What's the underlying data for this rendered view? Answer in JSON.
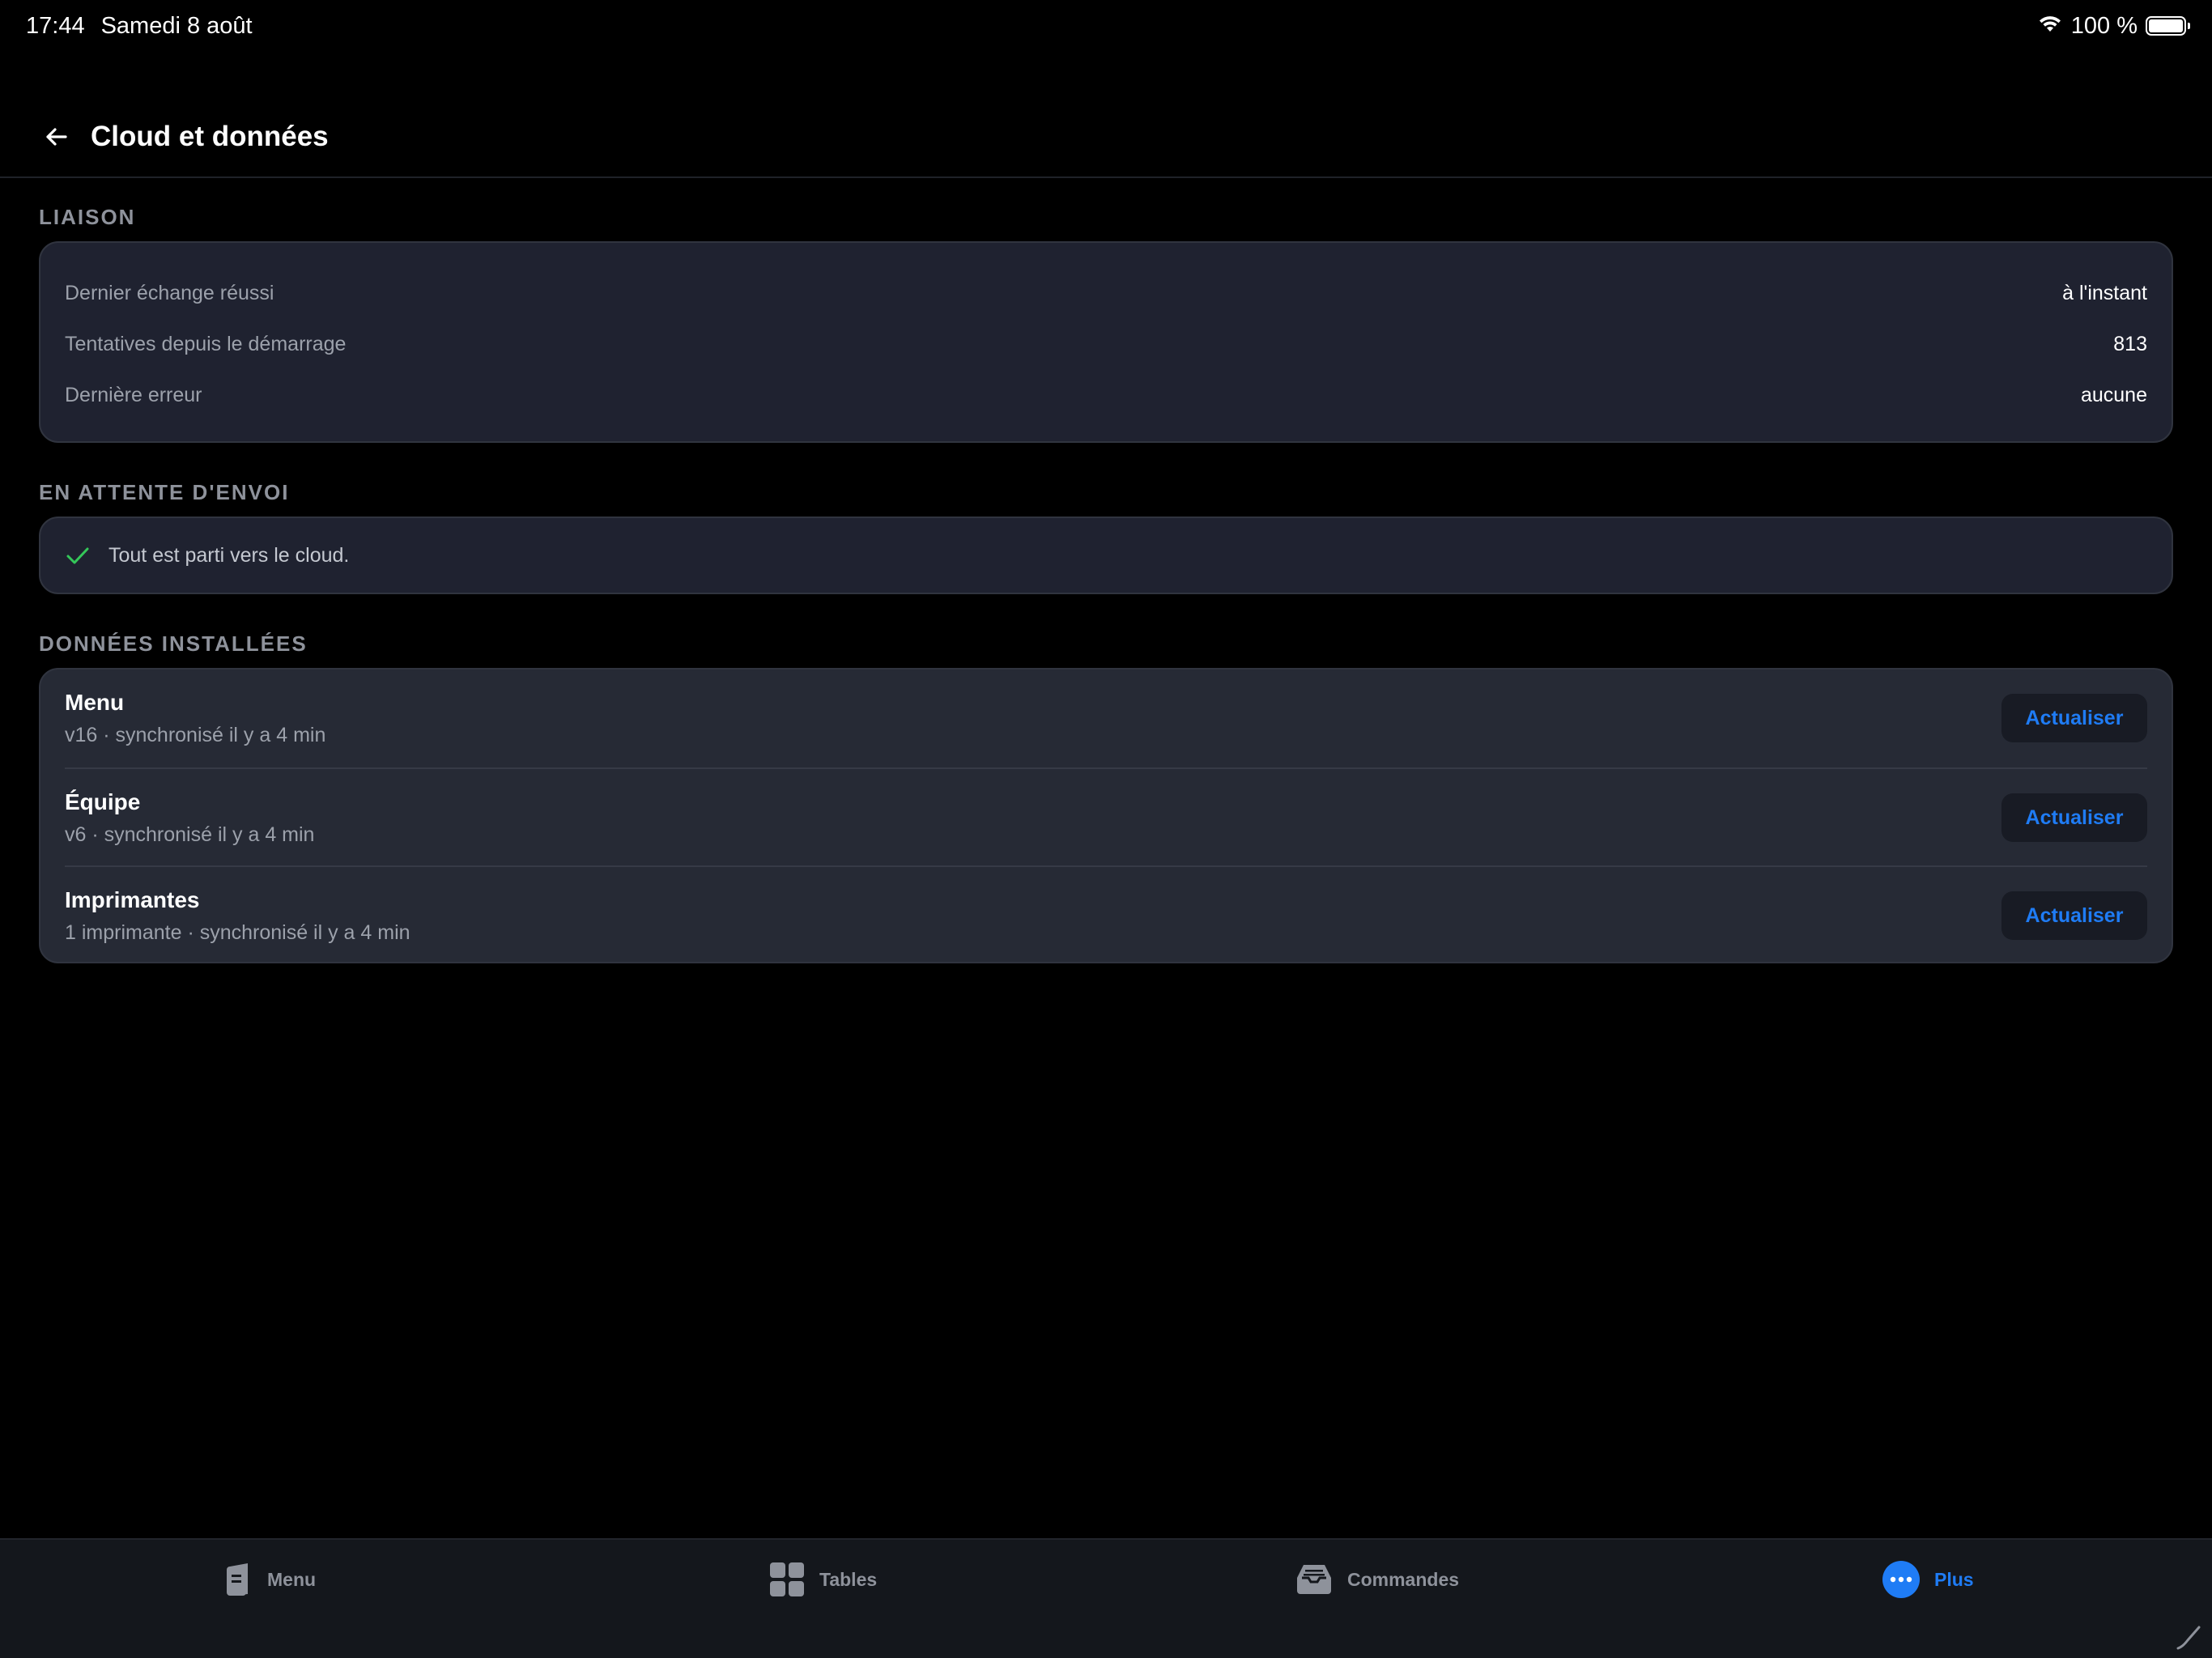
{
  "status_bar": {
    "time": "17:44",
    "date": "Samedi 8 août",
    "battery": "100 %"
  },
  "header": {
    "title": "Cloud et données"
  },
  "liaison": {
    "label": "LIAISON",
    "rows": [
      {
        "key": "Dernier échange réussi",
        "value": "à l'instant"
      },
      {
        "key": "Tentatives depuis le démarrage",
        "value": "813"
      },
      {
        "key": "Dernière erreur",
        "value": "aucune"
      }
    ]
  },
  "pending": {
    "label": "EN ATTENTE D'ENVOI",
    "message": "Tout est parti vers le cloud.",
    "check_color": "#34c759"
  },
  "installed": {
    "label": "DONNÉES INSTALLÉES",
    "items": [
      {
        "name": "Menu",
        "meta": "v16 · synchronisé il y a 4 min",
        "action": "Actualiser"
      },
      {
        "name": "Équipe",
        "meta": "v6 · synchronisé il y a 4 min",
        "action": "Actualiser"
      },
      {
        "name": "Imprimantes",
        "meta": "1 imprimante · synchronisé il y a 4 min",
        "action": "Actualiser"
      }
    ]
  },
  "tab_bar": {
    "tabs": [
      {
        "label": "Menu",
        "icon": "menu-book-icon",
        "active": false
      },
      {
        "label": "Tables",
        "icon": "tables-grid-icon",
        "active": false
      },
      {
        "label": "Commandes",
        "icon": "inbox-tray-icon",
        "active": false
      },
      {
        "label": "Plus",
        "icon": "more-dots-icon",
        "active": true
      }
    ],
    "accent": "#1f7cf5"
  }
}
